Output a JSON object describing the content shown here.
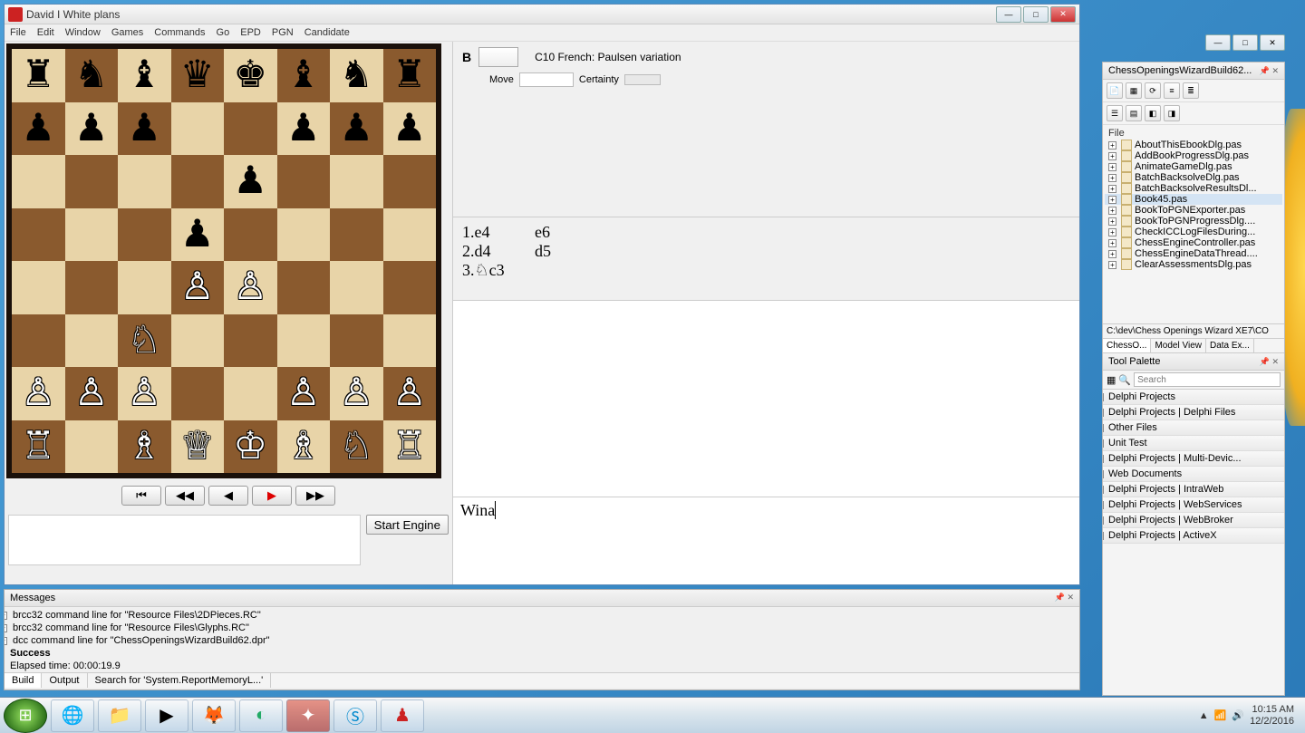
{
  "chess_window": {
    "title": "David I White plans",
    "menus": [
      "File",
      "Edit",
      "Window",
      "Games",
      "Commands",
      "Go",
      "EPD",
      "PGN",
      "Candidate"
    ],
    "opening": "C10  French: Paulsen variation",
    "assessment_label": "B",
    "move_label": "Move",
    "certainty_label": "Certainty",
    "notation": [
      {
        "num": "1.",
        "w": "e4",
        "b": "e6"
      },
      {
        "num": "2.",
        "w": "d4",
        "b": "d5"
      },
      {
        "num": "3.",
        "w": "♘c3",
        "b": ""
      }
    ],
    "typed_text": "Wina",
    "start_engine": "Start Engine",
    "board": [
      [
        "r",
        "n",
        "b",
        "q",
        "k",
        "b",
        "n",
        "r"
      ],
      [
        "p",
        "p",
        "p",
        "",
        "",
        "p",
        "p",
        "p"
      ],
      [
        "",
        "",
        "",
        "",
        "p",
        "",
        "",
        ""
      ],
      [
        "",
        "",
        "",
        "p",
        "",
        "",
        "",
        ""
      ],
      [
        "",
        "",
        "",
        "P",
        "P",
        "",
        "",
        ""
      ],
      [
        "",
        "",
        "N",
        "",
        "",
        "",
        "",
        ""
      ],
      [
        "P",
        "P",
        "P",
        "",
        "",
        "P",
        "P",
        "P"
      ],
      [
        "R",
        "",
        "B",
        "Q",
        "K",
        "B",
        "N",
        "R"
      ]
    ]
  },
  "messages": {
    "title": "Messages",
    "lines": [
      "brcc32 command line for \"Resource Files\\2DPieces.RC\"",
      "brcc32 command line for \"Resource Files\\Glyphs.RC\"",
      "dcc command line for \"ChessOpeningsWizardBuild62.dpr\"",
      "Success",
      "Elapsed time: 00:00:19.9"
    ],
    "tabs": [
      "Build",
      "Output",
      "Search for 'System.ReportMemoryL...'"
    ]
  },
  "ide": {
    "project_title": "ChessOpeningsWizardBuild62...",
    "file_label": "File",
    "files": [
      "AboutThisEbookDlg.pas",
      "AddBookProgressDlg.pas",
      "AnimateGameDlg.pas",
      "BatchBacksolveDlg.pas",
      "BatchBacksolveResultsDl...",
      "Book45.pas",
      "BookToPGNExporter.pas",
      "BookToPGNProgressDlg....",
      "CheckICCLogFilesDuring...",
      "ChessEngineController.pas",
      "ChessEngineDataThread....",
      "ClearAssessmentsDlg.pas"
    ],
    "path": "C:\\dev\\Chess Openings Wizard XE7\\CO",
    "project_tabs": [
      "ChessO...",
      "Model View",
      "Data Ex..."
    ],
    "palette_title": "Tool Palette",
    "search_placeholder": "Search",
    "categories": [
      "Delphi Projects",
      "Delphi Projects | Delphi Files",
      "Other Files",
      "Unit Test",
      "Delphi Projects | Multi-Devic...",
      "Web Documents",
      "Delphi Projects | IntraWeb",
      "Delphi Projects | WebServices",
      "Delphi Projects | WebBroker",
      "Delphi Projects | ActiveX"
    ]
  },
  "taskbar": {
    "time": "10:15 AM",
    "date": "12/2/2016"
  }
}
